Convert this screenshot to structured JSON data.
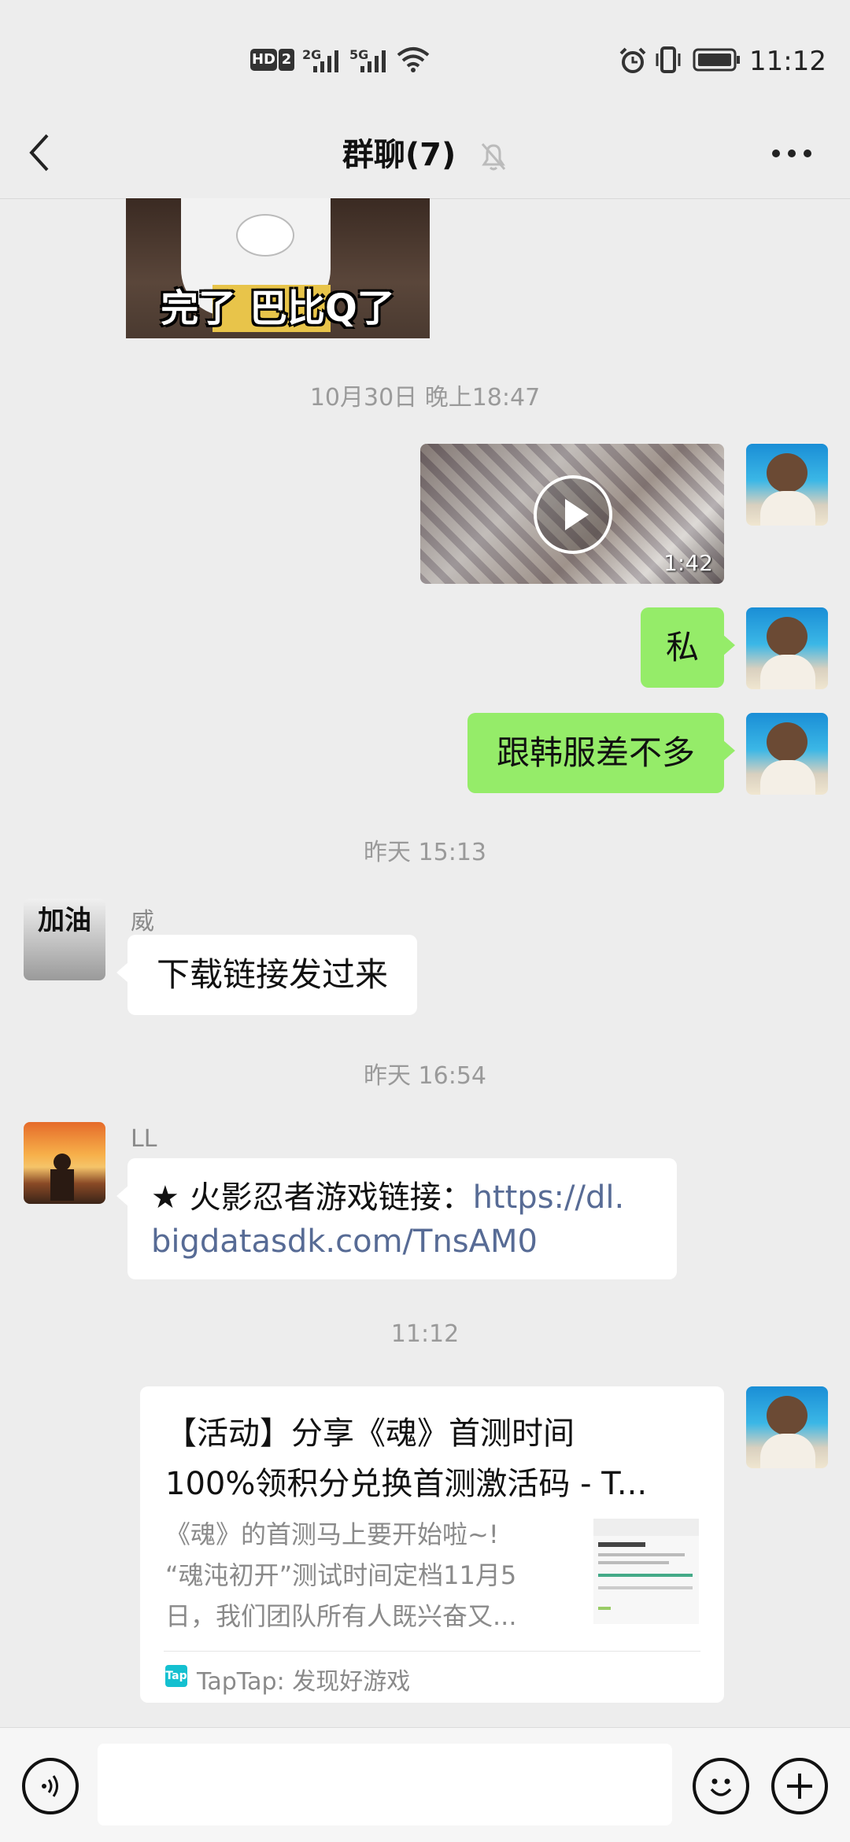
{
  "status_bar": {
    "hd_badge": "HD",
    "sim2": "2",
    "net1": "2G",
    "net2": "5G",
    "time": "11:12"
  },
  "header": {
    "title": "群聊(7)"
  },
  "chat": {
    "sticker_caption": "完了 巴比Q了",
    "timestamp1": "10月30日 晚上18:47",
    "video_duration": "1:42",
    "msg_si": "私",
    "msg_hanfu": "跟韩服差不多",
    "timestamp2": "昨天 15:13",
    "wei_nick": "威",
    "wei_avatar_text": "加油",
    "wei_msg": "下载链接发过来",
    "timestamp3": "昨天 16:54",
    "ll_nick": "LL",
    "ll_msg_prefix": "★ 火影忍者游戏链接：",
    "ll_link_part1": "https://dl.",
    "ll_link_part2": "bigdatasdk.com/TnsAM0",
    "timestamp4": "11:12",
    "card": {
      "title_line1": "【活动】分享《魂》首测时间",
      "title_line2": "100%领积分兑换首测激活码 - T...",
      "desc_line1": "《魂》的首测马上要开始啦~!",
      "desc_line2": "“魂沌初开”测试时间定档11月5",
      "desc_line3": "日，我们团队所有人既兴奋又...",
      "source_icon": "Tap",
      "source": "TapTap: 发现好游戏"
    }
  },
  "colors": {
    "bubble_green": "#95ec69",
    "link": "#576b95",
    "background": "#ededed"
  }
}
